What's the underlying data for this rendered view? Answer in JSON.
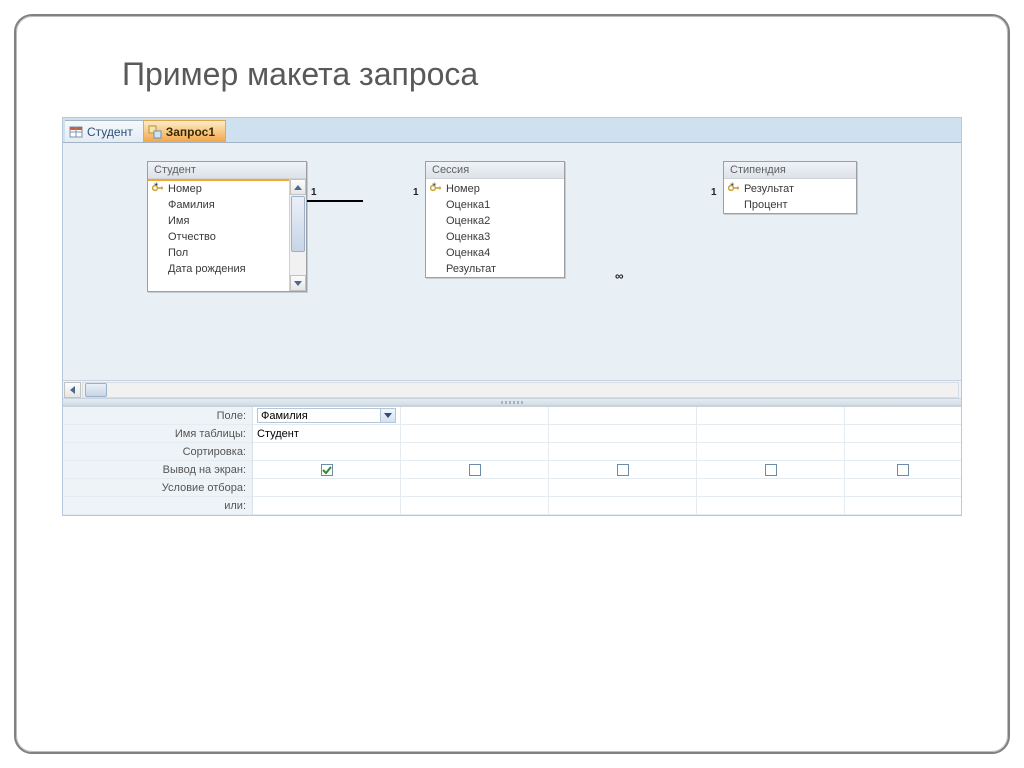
{
  "slide": {
    "title": "Пример макета запроса"
  },
  "tabs": {
    "table_tab": "Студент",
    "query_tab": "Запрос1"
  },
  "tables": {
    "t1": {
      "title": "Студент",
      "star": "*",
      "fields": [
        "Номер",
        "Фамилия",
        "Имя",
        "Отчество",
        "Пол",
        "Дата рождения"
      ]
    },
    "t2": {
      "title": "Сессия",
      "star": "*",
      "fields": [
        "Номер",
        "Оценка1",
        "Оценка2",
        "Оценка3",
        "Оценка4",
        "Результат"
      ]
    },
    "t3": {
      "title": "Стипендия",
      "star": "*",
      "fields": [
        "Результат",
        "Процент"
      ]
    }
  },
  "relations": {
    "r1_left": "1",
    "r1_right": "1",
    "r2_left": "∞",
    "r2_right": "1"
  },
  "grid": {
    "labels": {
      "field": "Поле:",
      "table": "Имя таблицы:",
      "sort": "Сортировка:",
      "show": "Вывод на экран:",
      "criteria": "Условие отбора:",
      "or": "или:"
    },
    "col1_field": "Фамилия",
    "col1_table": "Студент"
  }
}
